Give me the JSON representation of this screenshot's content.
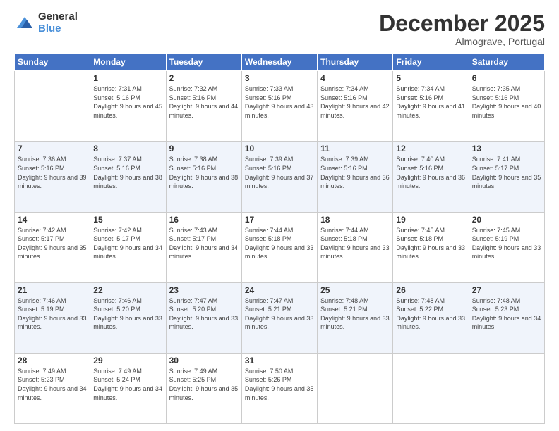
{
  "logo": {
    "general": "General",
    "blue": "Blue"
  },
  "header": {
    "month": "December 2025",
    "location": "Almograve, Portugal"
  },
  "weekdays": [
    "Sunday",
    "Monday",
    "Tuesday",
    "Wednesday",
    "Thursday",
    "Friday",
    "Saturday"
  ],
  "weeks": [
    [
      {
        "day": "",
        "sunrise": "",
        "sunset": "",
        "daylight": ""
      },
      {
        "day": "1",
        "sunrise": "Sunrise: 7:31 AM",
        "sunset": "Sunset: 5:16 PM",
        "daylight": "Daylight: 9 hours and 45 minutes."
      },
      {
        "day": "2",
        "sunrise": "Sunrise: 7:32 AM",
        "sunset": "Sunset: 5:16 PM",
        "daylight": "Daylight: 9 hours and 44 minutes."
      },
      {
        "day": "3",
        "sunrise": "Sunrise: 7:33 AM",
        "sunset": "Sunset: 5:16 PM",
        "daylight": "Daylight: 9 hours and 43 minutes."
      },
      {
        "day": "4",
        "sunrise": "Sunrise: 7:34 AM",
        "sunset": "Sunset: 5:16 PM",
        "daylight": "Daylight: 9 hours and 42 minutes."
      },
      {
        "day": "5",
        "sunrise": "Sunrise: 7:34 AM",
        "sunset": "Sunset: 5:16 PM",
        "daylight": "Daylight: 9 hours and 41 minutes."
      },
      {
        "day": "6",
        "sunrise": "Sunrise: 7:35 AM",
        "sunset": "Sunset: 5:16 PM",
        "daylight": "Daylight: 9 hours and 40 minutes."
      }
    ],
    [
      {
        "day": "7",
        "sunrise": "Sunrise: 7:36 AM",
        "sunset": "Sunset: 5:16 PM",
        "daylight": "Daylight: 9 hours and 39 minutes."
      },
      {
        "day": "8",
        "sunrise": "Sunrise: 7:37 AM",
        "sunset": "Sunset: 5:16 PM",
        "daylight": "Daylight: 9 hours and 38 minutes."
      },
      {
        "day": "9",
        "sunrise": "Sunrise: 7:38 AM",
        "sunset": "Sunset: 5:16 PM",
        "daylight": "Daylight: 9 hours and 38 minutes."
      },
      {
        "day": "10",
        "sunrise": "Sunrise: 7:39 AM",
        "sunset": "Sunset: 5:16 PM",
        "daylight": "Daylight: 9 hours and 37 minutes."
      },
      {
        "day": "11",
        "sunrise": "Sunrise: 7:39 AM",
        "sunset": "Sunset: 5:16 PM",
        "daylight": "Daylight: 9 hours and 36 minutes."
      },
      {
        "day": "12",
        "sunrise": "Sunrise: 7:40 AM",
        "sunset": "Sunset: 5:16 PM",
        "daylight": "Daylight: 9 hours and 36 minutes."
      },
      {
        "day": "13",
        "sunrise": "Sunrise: 7:41 AM",
        "sunset": "Sunset: 5:17 PM",
        "daylight": "Daylight: 9 hours and 35 minutes."
      }
    ],
    [
      {
        "day": "14",
        "sunrise": "Sunrise: 7:42 AM",
        "sunset": "Sunset: 5:17 PM",
        "daylight": "Daylight: 9 hours and 35 minutes."
      },
      {
        "day": "15",
        "sunrise": "Sunrise: 7:42 AM",
        "sunset": "Sunset: 5:17 PM",
        "daylight": "Daylight: 9 hours and 34 minutes."
      },
      {
        "day": "16",
        "sunrise": "Sunrise: 7:43 AM",
        "sunset": "Sunset: 5:17 PM",
        "daylight": "Daylight: 9 hours and 34 minutes."
      },
      {
        "day": "17",
        "sunrise": "Sunrise: 7:44 AM",
        "sunset": "Sunset: 5:18 PM",
        "daylight": "Daylight: 9 hours and 33 minutes."
      },
      {
        "day": "18",
        "sunrise": "Sunrise: 7:44 AM",
        "sunset": "Sunset: 5:18 PM",
        "daylight": "Daylight: 9 hours and 33 minutes."
      },
      {
        "day": "19",
        "sunrise": "Sunrise: 7:45 AM",
        "sunset": "Sunset: 5:18 PM",
        "daylight": "Daylight: 9 hours and 33 minutes."
      },
      {
        "day": "20",
        "sunrise": "Sunrise: 7:45 AM",
        "sunset": "Sunset: 5:19 PM",
        "daylight": "Daylight: 9 hours and 33 minutes."
      }
    ],
    [
      {
        "day": "21",
        "sunrise": "Sunrise: 7:46 AM",
        "sunset": "Sunset: 5:19 PM",
        "daylight": "Daylight: 9 hours and 33 minutes."
      },
      {
        "day": "22",
        "sunrise": "Sunrise: 7:46 AM",
        "sunset": "Sunset: 5:20 PM",
        "daylight": "Daylight: 9 hours and 33 minutes."
      },
      {
        "day": "23",
        "sunrise": "Sunrise: 7:47 AM",
        "sunset": "Sunset: 5:20 PM",
        "daylight": "Daylight: 9 hours and 33 minutes."
      },
      {
        "day": "24",
        "sunrise": "Sunrise: 7:47 AM",
        "sunset": "Sunset: 5:21 PM",
        "daylight": "Daylight: 9 hours and 33 minutes."
      },
      {
        "day": "25",
        "sunrise": "Sunrise: 7:48 AM",
        "sunset": "Sunset: 5:21 PM",
        "daylight": "Daylight: 9 hours and 33 minutes."
      },
      {
        "day": "26",
        "sunrise": "Sunrise: 7:48 AM",
        "sunset": "Sunset: 5:22 PM",
        "daylight": "Daylight: 9 hours and 33 minutes."
      },
      {
        "day": "27",
        "sunrise": "Sunrise: 7:48 AM",
        "sunset": "Sunset: 5:23 PM",
        "daylight": "Daylight: 9 hours and 34 minutes."
      }
    ],
    [
      {
        "day": "28",
        "sunrise": "Sunrise: 7:49 AM",
        "sunset": "Sunset: 5:23 PM",
        "daylight": "Daylight: 9 hours and 34 minutes."
      },
      {
        "day": "29",
        "sunrise": "Sunrise: 7:49 AM",
        "sunset": "Sunset: 5:24 PM",
        "daylight": "Daylight: 9 hours and 34 minutes."
      },
      {
        "day": "30",
        "sunrise": "Sunrise: 7:49 AM",
        "sunset": "Sunset: 5:25 PM",
        "daylight": "Daylight: 9 hours and 35 minutes."
      },
      {
        "day": "31",
        "sunrise": "Sunrise: 7:50 AM",
        "sunset": "Sunset: 5:26 PM",
        "daylight": "Daylight: 9 hours and 35 minutes."
      },
      {
        "day": "",
        "sunrise": "",
        "sunset": "",
        "daylight": ""
      },
      {
        "day": "",
        "sunrise": "",
        "sunset": "",
        "daylight": ""
      },
      {
        "day": "",
        "sunrise": "",
        "sunset": "",
        "daylight": ""
      }
    ]
  ]
}
